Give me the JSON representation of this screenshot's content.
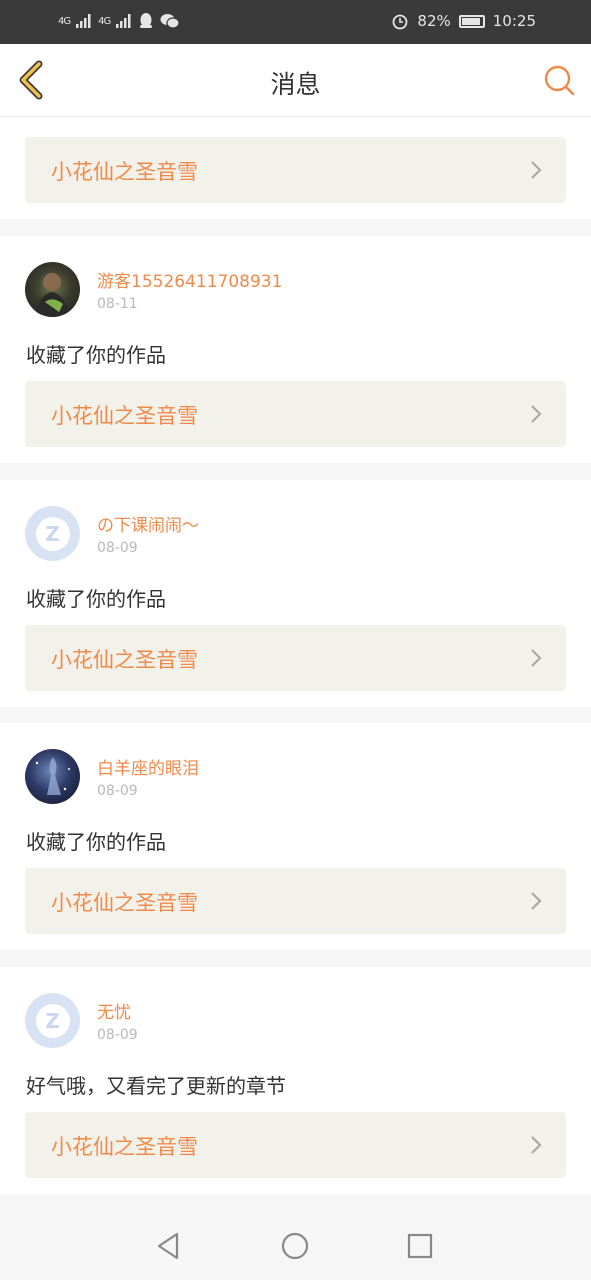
{
  "status_bar": {
    "signal1": "4G",
    "signal2": "4G",
    "battery_percent": "82%",
    "battery_level": 0.82,
    "time": "10:25"
  },
  "header": {
    "title": "消息",
    "accent_color": "#f08a4b"
  },
  "top_card": {
    "work_title": "小花仙之圣音雪"
  },
  "messages": [
    {
      "username": "游客15526411708931",
      "date": "08-11",
      "text": "收藏了你的作品",
      "work_title": "小花仙之圣音雪",
      "avatar": "photo"
    },
    {
      "username": "の下课闹闹～",
      "date": "08-09",
      "text": "收藏了你的作品",
      "work_title": "小花仙之圣音雪",
      "avatar": "default-qq"
    },
    {
      "username": "白羊座的眼泪",
      "date": "08-09",
      "text": "收藏了你的作品",
      "work_title": "小花仙之圣音雪",
      "avatar": "photo"
    },
    {
      "username": "无忧",
      "date": "08-09",
      "text": "好气哦，又看完了更新的章节",
      "work_title": "小花仙之圣音雪",
      "avatar": "default-qq"
    }
  ],
  "nav": {
    "back": "back-triangle-icon",
    "home": "home-circle-icon",
    "recents": "recents-square-icon"
  }
}
